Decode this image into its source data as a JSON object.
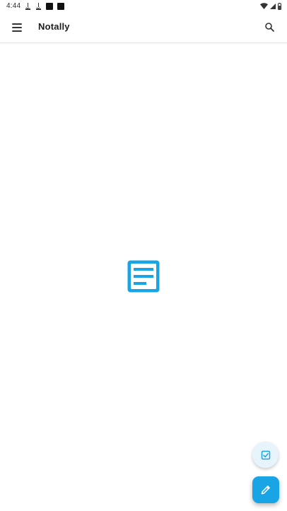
{
  "status_bar": {
    "time": "4:44",
    "notification_icons": [
      "download-icon",
      "download-icon",
      "app-square-icon",
      "app-square-icon"
    ],
    "system_icons": [
      "wifi-icon",
      "cell-signal-icon",
      "battery-icon"
    ]
  },
  "app_bar": {
    "title": "Notally",
    "left_icon": "hamburger-menu-icon",
    "right_icon": "search-icon"
  },
  "empty_state": {
    "icon": "note-icon"
  },
  "fabs": {
    "secondary_icon": "checklist-icon",
    "primary_icon": "pencil-icon"
  },
  "colors": {
    "accent": "#19a4e6",
    "accent_light": "#e8f4fb",
    "background": "#ffffff",
    "text": "#1d1d1d"
  }
}
